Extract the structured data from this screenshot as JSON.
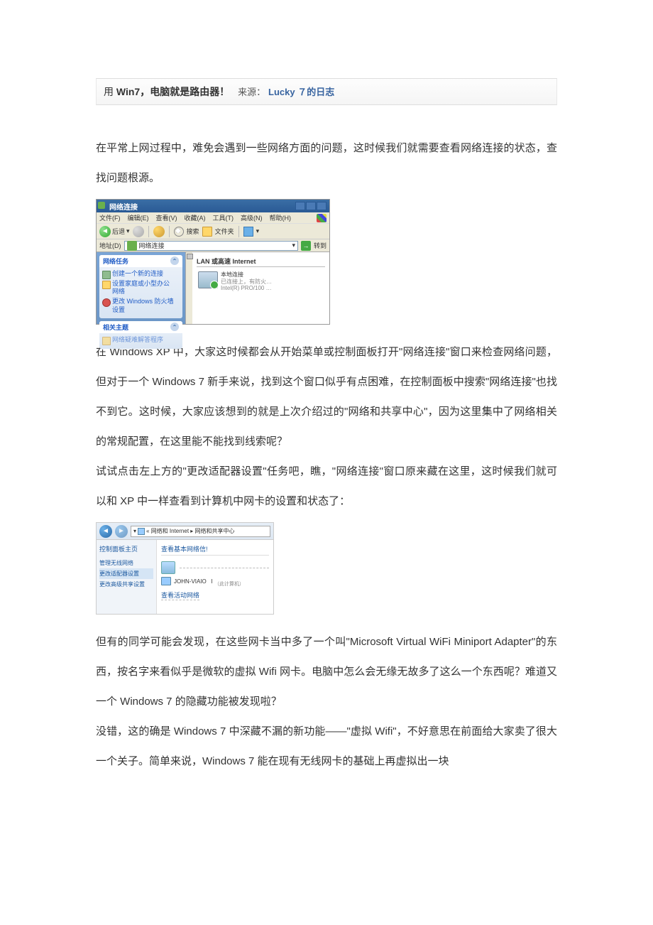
{
  "title": {
    "prefix": "用 ",
    "bold1": "Win7",
    "middle": "，电脑就是路由器！",
    "source_label": "来源：",
    "source_link_pre": "Lucky ７",
    "source_link_post": "的日志"
  },
  "para1": "在平常上网过程中，难免会遇到一些网络方面的问题，这时候我们就需要查看网络连接的状态，查找问题根源。",
  "xp": {
    "window_title": "网络连接",
    "menu": {
      "file": "文件(F)",
      "edit": "编辑(E)",
      "view": "查看(V)",
      "fav": "收藏(A)",
      "tools": "工具(T)",
      "adv": "高级(N)",
      "help": "帮助(H)"
    },
    "toolbar": {
      "back": "后退",
      "search": "搜索",
      "folder": "文件夹"
    },
    "addr_label": "地址(D)",
    "addr_value": "网络连接",
    "go": "转到",
    "side": {
      "tasks_hdr": "网络任务",
      "task1": "创建一个新的连接",
      "task2_a": "设置家庭或小型办公",
      "task2_b": "网络",
      "task3_a": "更改 Windows 防火墙",
      "task3_b": "设置",
      "related_hdr": "相关主题",
      "related1": "网络疑难解答程序"
    },
    "main": {
      "group": "LAN 或高速 Internet",
      "conn_name": "本地连接",
      "conn_status": "已连接上，有防火…",
      "conn_device": "Intel(R) PRO/100 …"
    }
  },
  "para2": "在 Windows XP 中，大家这时候都会从开始菜单或控制面板打开\"网络连接\"窗口来检查网络问题，但对于一个 Windows 7 新手来说，找到这个窗口似乎有点困难，在控制面板中搜索\"网络连接\"也找不到它。这时候，大家应该想到的就是上次介绍过的\"网络和共享中心\"，因为这里集中了网络相关的常规配置，在这里能不能找到线索呢？",
  "para3": "试试点击左上方的\"更改适配器设置\"任务吧，瞧，\"网络连接\"窗口原来藏在这里，这时候我们就可以和 XP 中一样查看到计算机中网卡的设置和状态了：",
  "w7": {
    "bread": "« 网络和 Internet ▸ 网络和共享中心",
    "side": {
      "cph": "控制面板主页",
      "lnk1": "管理无线网络",
      "lnk2": "更改适配器设置",
      "lnk3": "更改高级共享设置"
    },
    "main": {
      "heading": "查看基本网络信!",
      "comp_name": "JOHN-VIAIO",
      "comp_sub": "（此计算机）",
      "active": "查看活动网络"
    }
  },
  "para4": "但有的同学可能会发现，在这些网卡当中多了一个叫\"Microsoft Virtual WiFi Miniport Adapter\"的东西，按名字来看似乎是微软的虚拟 Wifi 网卡。电脑中怎么会无缘无故多了这么一个东西呢？难道又一个 Windows 7 的隐藏功能被发现啦？",
  "para5": "没错，这的确是 Windows 7 中深藏不漏的新功能——\"虚拟 Wifi\"，不好意思在前面给大家卖了很大一个关子。简单来说，Windows 7 能在现有无线网卡的基础上再虚拟出一块"
}
